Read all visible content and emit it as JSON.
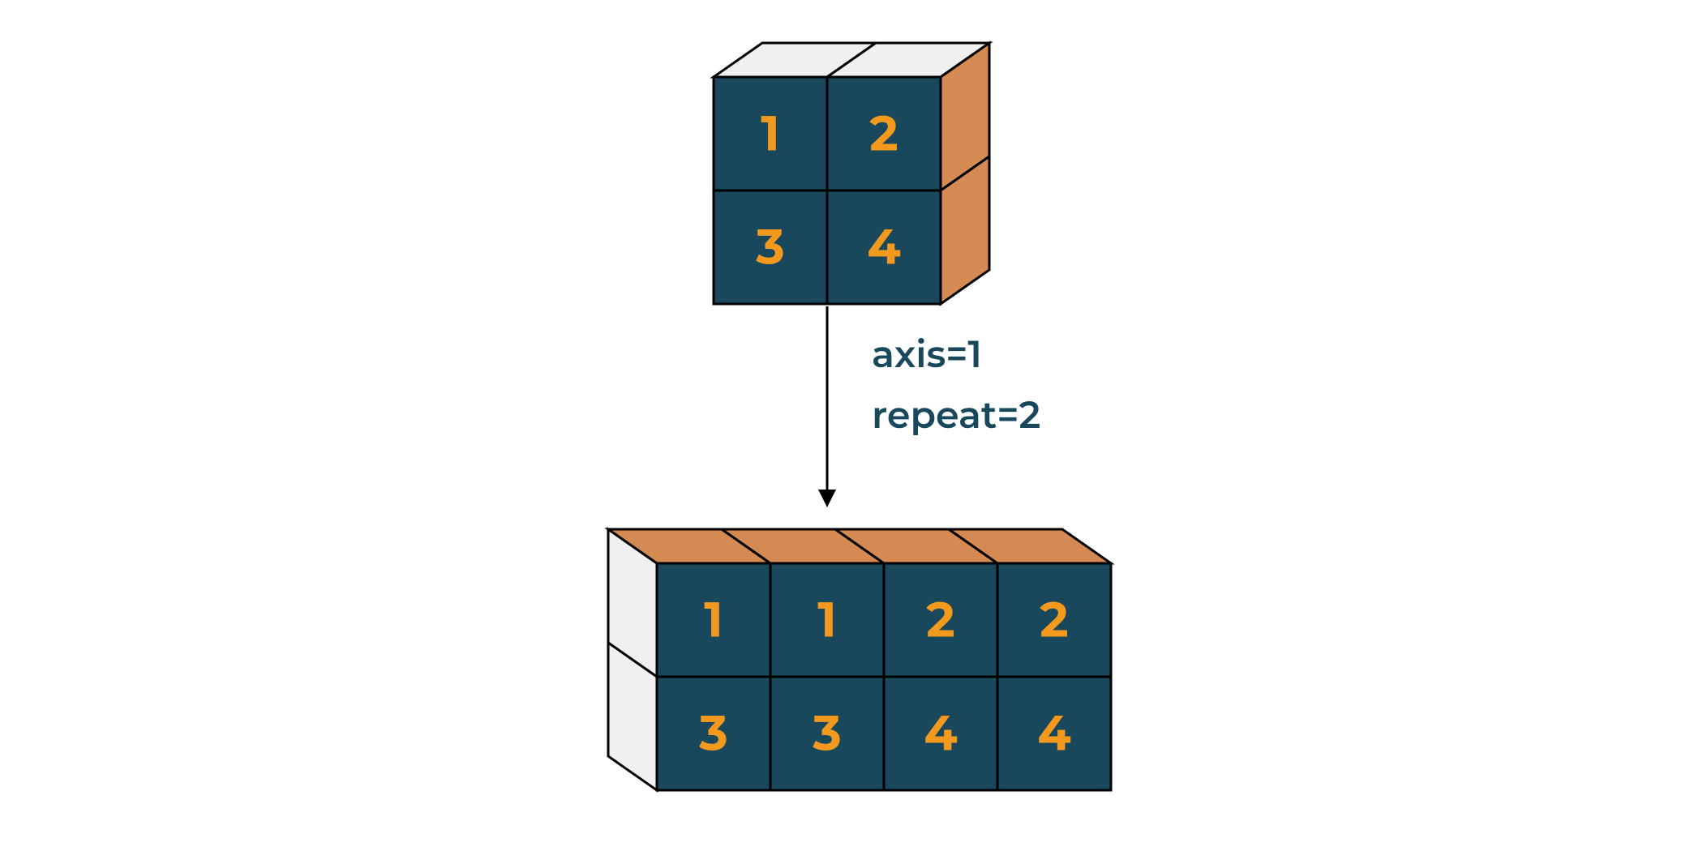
{
  "diagram": {
    "source": {
      "top_faces": "light",
      "side_faces": "orange",
      "rows": 2,
      "cols": 2,
      "values": [
        [
          "1",
          "2"
        ],
        [
          "3",
          "4"
        ]
      ]
    },
    "operation": {
      "line1": "axis=1",
      "line2": "repeat=2"
    },
    "result": {
      "top_faces": "orange",
      "side_faces": "light",
      "rows": 2,
      "cols": 4,
      "values": [
        [
          "1",
          "1",
          "2",
          "2"
        ],
        [
          "3",
          "3",
          "4",
          "4"
        ]
      ]
    },
    "colors": {
      "front": "#19475b",
      "number": "#f39a1e",
      "orange_face": "#d58a53",
      "light_face": "#f0f0f0",
      "label": "#19475b"
    }
  }
}
